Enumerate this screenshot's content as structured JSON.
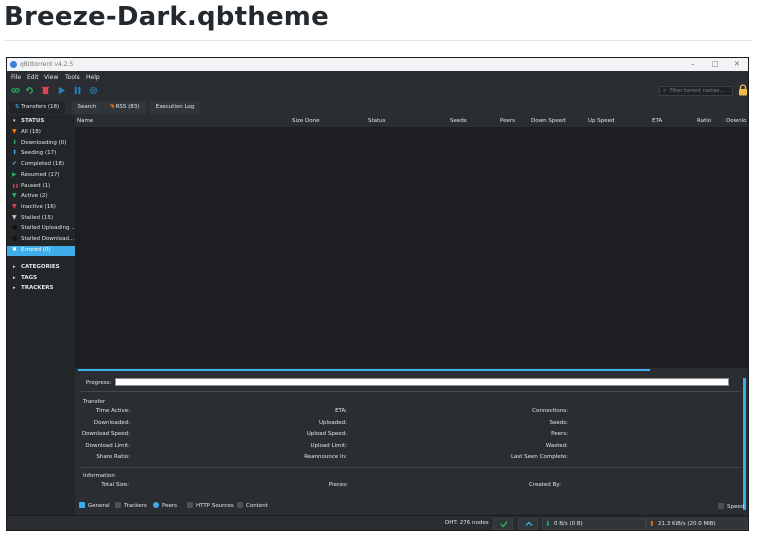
{
  "page": {
    "heading": "Breeze-Dark.qbtheme"
  },
  "window": {
    "title": "qBittorrent v4.2.5",
    "controls": {
      "minimize": "–",
      "maximize": "□",
      "close": "✕"
    }
  },
  "menu": [
    "File",
    "Edit",
    "View",
    "Tools",
    "Help"
  ],
  "toolbar": {
    "icons": [
      "add-link-icon",
      "add-torrent-icon",
      "delete-icon",
      "resume-icon",
      "pause-icon",
      "options-icon"
    ],
    "filter_placeholder": "Filter torrent names..."
  },
  "tabs": [
    {
      "label": "Transfers (18)",
      "active": true
    },
    {
      "label": "Search",
      "active": false
    },
    {
      "label": "RSS (83)",
      "active": false
    },
    {
      "label": "Execution Log",
      "active": false
    }
  ],
  "sidebar": {
    "status_header": "STATUS",
    "status_items": [
      {
        "label": "All (18)",
        "icon": "filter-icon",
        "color": "#f67400"
      },
      {
        "label": "Downloading (0)",
        "icon": "download-icon",
        "color": "#27ae60"
      },
      {
        "label": "Seeding (17)",
        "icon": "upload-icon",
        "color": "#3daee9"
      },
      {
        "label": "Completed (18)",
        "icon": "check-icon",
        "color": "#3daee9"
      },
      {
        "label": "Resumed (17)",
        "icon": "play-icon",
        "color": "#27ae60"
      },
      {
        "label": "Paused (1)",
        "icon": "pause-icon",
        "color": "#da4453"
      },
      {
        "label": "Active (2)",
        "icon": "filter-icon",
        "color": "#27ae60"
      },
      {
        "label": "Inactive (16)",
        "icon": "filter-icon",
        "color": "#da4453"
      },
      {
        "label": "Stalled (15)",
        "icon": "filter-icon",
        "color": "#bdc3c7"
      },
      {
        "label": "Stalled Uploading ...",
        "icon": "dot-icon",
        "color": "#111111"
      },
      {
        "label": "Stalled Download...",
        "icon": "dot-icon",
        "color": "#111111"
      },
      {
        "label": "Errored (0)",
        "icon": "error-icon",
        "color": "#ffffff",
        "selected": true
      }
    ],
    "sections": [
      "CATEGORIES",
      "TAGS",
      "TRACKERS"
    ]
  },
  "columns": [
    "Name",
    "Size Done",
    "Status",
    "Seeds",
    "Peers",
    "Down Speed",
    "Up Speed",
    "ETA",
    "Ratio",
    "Downlo"
  ],
  "properties": {
    "progress_label": "Progress:",
    "progress_value": 0.0,
    "transfer_title": "Transfer",
    "transfer_fields": {
      "col1": [
        "Time Active:",
        "Downloaded:",
        "Download Speed:",
        "Download Limit:",
        "Share Ratio:"
      ],
      "col2": [
        "ETA:",
        "Uploaded:",
        "Upload Speed:",
        "Upload Limit:",
        "Reannounce In:"
      ],
      "col3": [
        "Connections:",
        "Seeds:",
        "Peers:",
        "Wasted:",
        "Last Seen Complete:"
      ]
    },
    "information_title": "Information",
    "information_fields": [
      "Total Size:",
      "Pieces:",
      "Created By:"
    ]
  },
  "bottom_tabs": [
    "General",
    "Trackers",
    "Peers",
    "HTTP Sources",
    "Content"
  ],
  "speed_label": "Speed",
  "status_bar": {
    "dht": "DHT: 276 nodes",
    "download": "0 B/s (0 B)",
    "upload": "21.3 KiB/s (20.0 MiB)"
  },
  "colors": {
    "accent": "#3daee9",
    "bg": "#2a2e32",
    "panel": "#232629",
    "list_bg": "#1c1e21"
  }
}
